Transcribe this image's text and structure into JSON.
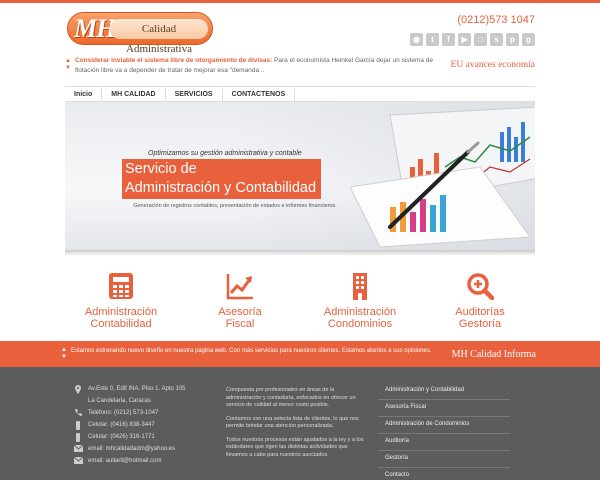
{
  "header": {
    "logo_initials": "MH",
    "logo_name": "Calidad Administrativa",
    "phone": "(0212)573 1047",
    "social_icons": [
      "rss-icon",
      "twitter-icon",
      "facebook-icon",
      "youtube-icon",
      "instagram-icon",
      "skype-icon",
      "pinterest-icon",
      "google-plus-icon"
    ]
  },
  "news": {
    "headline": "Considerar inviable el sistema libre de otorgamiento de divisas:",
    "body": "Para el economista Heinkel García dejar un sistema de flotación libre va a depender de tratar de mejorar esa \"demanda ..",
    "brand": "EU avances economía"
  },
  "nav": [
    "Inicio",
    "MH CALIDAD",
    "SERVICIOS",
    "CONTACTENOS"
  ],
  "hero": {
    "tagline": "Optimizamos su gestión administrativa y contable",
    "title_line1": "Servicio de",
    "title_line2": "Administración y Contabilidad",
    "description": "Generación de registros contables, presentación de estados e informes financieros."
  },
  "services": [
    {
      "line1": "Administración",
      "line2": "Contabilidad",
      "icon": "calculator-icon"
    },
    {
      "line1": "Asesoría",
      "line2": "Fiscal",
      "icon": "trend-chart-icon"
    },
    {
      "line1": "Administración",
      "line2": "Condominios",
      "icon": "building-icon"
    },
    {
      "line1": "Auditorías",
      "line2": "Gestoría",
      "icon": "magnifier-icon"
    }
  ],
  "band": {
    "text": "Estamos estrenando nuevo diseño en nuestra página web. Con más servicios para nuestros clientes. Estamos atentos a sus opiniones.",
    "brand": "MH Calidad Informa"
  },
  "footer": {
    "address_line1": "Av.Este 0, Edif INA. Piso 1. Apto 105",
    "address_line2": "La Candelaria, Caracas",
    "phone": "Teléfono: (0212) 573-1047",
    "cell1": "Celular: (0416) 838-3447",
    "cell2": "Celular: (0426) 316-1771",
    "email1": "email: mhcalidadadm@yahoo.es",
    "email2": "email: auliarll@hotmail.com",
    "about": [
      "Compuesta por profesionales en áreas de la administración y contaduría, enfocados en ofrecer un servicio de calidad al menor costo posible.",
      "Contamos con una selecta lista de clientes, lo que nos permite brindar una atención personalizada.",
      "Todos nuestros procesos están ajustados a la ley y a los estándares que rigen las distintas actividades que llevamos a cabo para nuestros asociados."
    ],
    "links": [
      "Administración y Contabilidad",
      "Asesoría Fiscal",
      "Administración de Condominios",
      "Auditoría",
      "Gestoría",
      "Contacto"
    ]
  },
  "colors": {
    "accent": "#e8603c",
    "footer_bg": "#5c5c5c"
  }
}
